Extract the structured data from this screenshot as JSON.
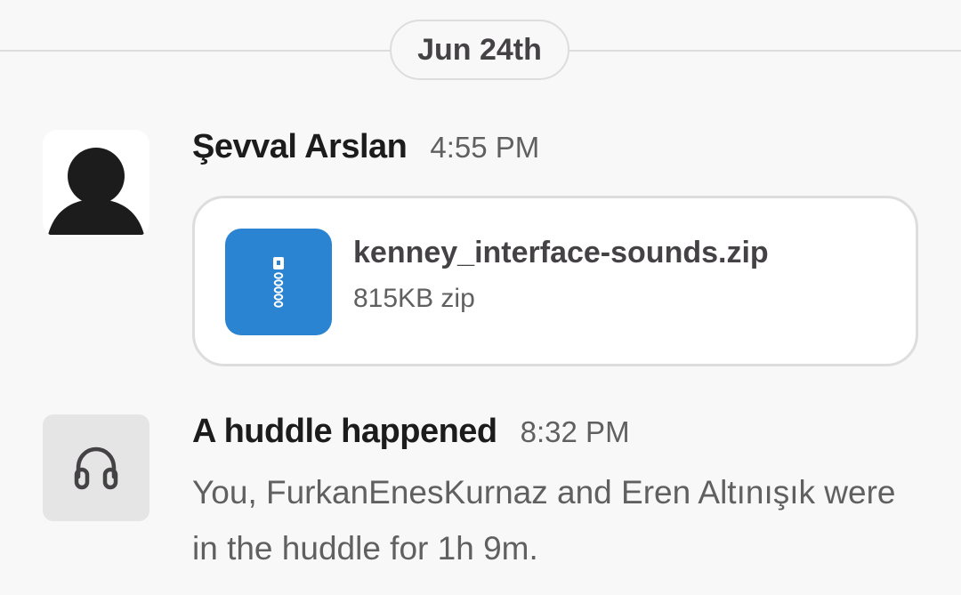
{
  "date_divider": {
    "label": "Jun 24th"
  },
  "messages": [
    {
      "sender": "Şevval Arslan",
      "time": "4:55 PM",
      "avatar_icon": "default-user-avatar-icon",
      "attachment": {
        "file_name": "kenney_interface-sounds.zip",
        "file_meta": "815KB zip",
        "icon": "zip-file-icon",
        "icon_color": "#2a84d2"
      }
    },
    {
      "sender": "A huddle happened",
      "time": "8:32 PM",
      "avatar_icon": "headphones-icon",
      "body": "You, FurkanEnesKurnaz and Eren Altınışık were in the huddle for 1h 9m."
    }
  ],
  "colors": {
    "background": "#f8f8f8",
    "text_primary": "#1d1c1d",
    "text_secondary": "#616061",
    "border": "#dddddd",
    "accent_file": "#2a84d2"
  }
}
